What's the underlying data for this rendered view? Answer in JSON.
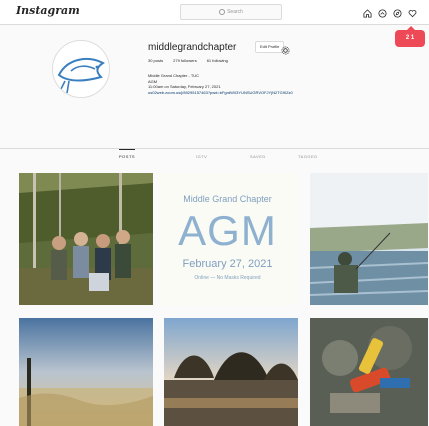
{
  "topbar": {
    "logo": "Instagram",
    "search_placeholder": "Search",
    "notification_badge": "2 1"
  },
  "profile": {
    "username": "middlegrandchapter",
    "edit_profile_label": "Edit Profile",
    "stats": {
      "posts": "30 posts",
      "followers": "279 followers",
      "following": "61 following"
    },
    "bio": {
      "line1": "Middle Grand Chapter - TUC",
      "line2": "AGM",
      "line3": "11:00am on Saturday, February 27, 2021",
      "link": "us02web.zoom.us/j/89295157463?pwd=bFgrdW03YUNSUGRVOFJYjN2TG9IZz0"
    }
  },
  "tabs": [
    "POSTS",
    "IGTV",
    "SAVED",
    "TAGGED"
  ],
  "posts": {
    "agm": {
      "title": "Middle Grand Chapter",
      "big": "AGM",
      "date": "February 27, 2021",
      "note": "Online — No Masks Required"
    }
  },
  "colors": {
    "accent": "#ed4956",
    "link": "#00376b",
    "agm_text": "#8fb1d0"
  }
}
